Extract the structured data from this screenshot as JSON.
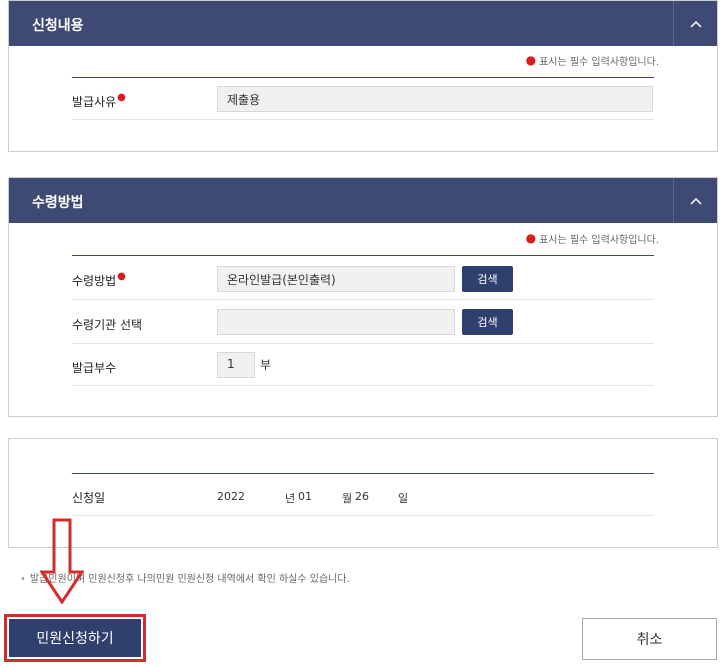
{
  "required_note": "표시는 필수 입력사항입니다.",
  "section1": {
    "title": "신청내용",
    "reason_label": "발급사유",
    "reason_value": "제출용"
  },
  "section2": {
    "title": "수령방법",
    "method_label": "수령방법",
    "method_value": "온라인발급(본인출력)",
    "search_label": "검색",
    "institution_label": "수령기관 선택",
    "institution_value": "",
    "copies_label": "발급부수",
    "copies_value": "1",
    "copies_unit": "부"
  },
  "section3": {
    "date_label": "신청일",
    "year": "2022",
    "year_unit": "년",
    "month": "01",
    "month_unit": "월",
    "day": "26",
    "day_unit": "일"
  },
  "notice": "발급민원이며 민원신청후 나의민원 민원신청 내역에서 확인 하실수 있습니다.",
  "buttons": {
    "submit": "민원신청하기",
    "cancel": "취소"
  },
  "colors": {
    "header": "#3f4a74",
    "button": "#2f3f6e",
    "highlight": "#d42b2b",
    "required": "#d91c1c"
  }
}
